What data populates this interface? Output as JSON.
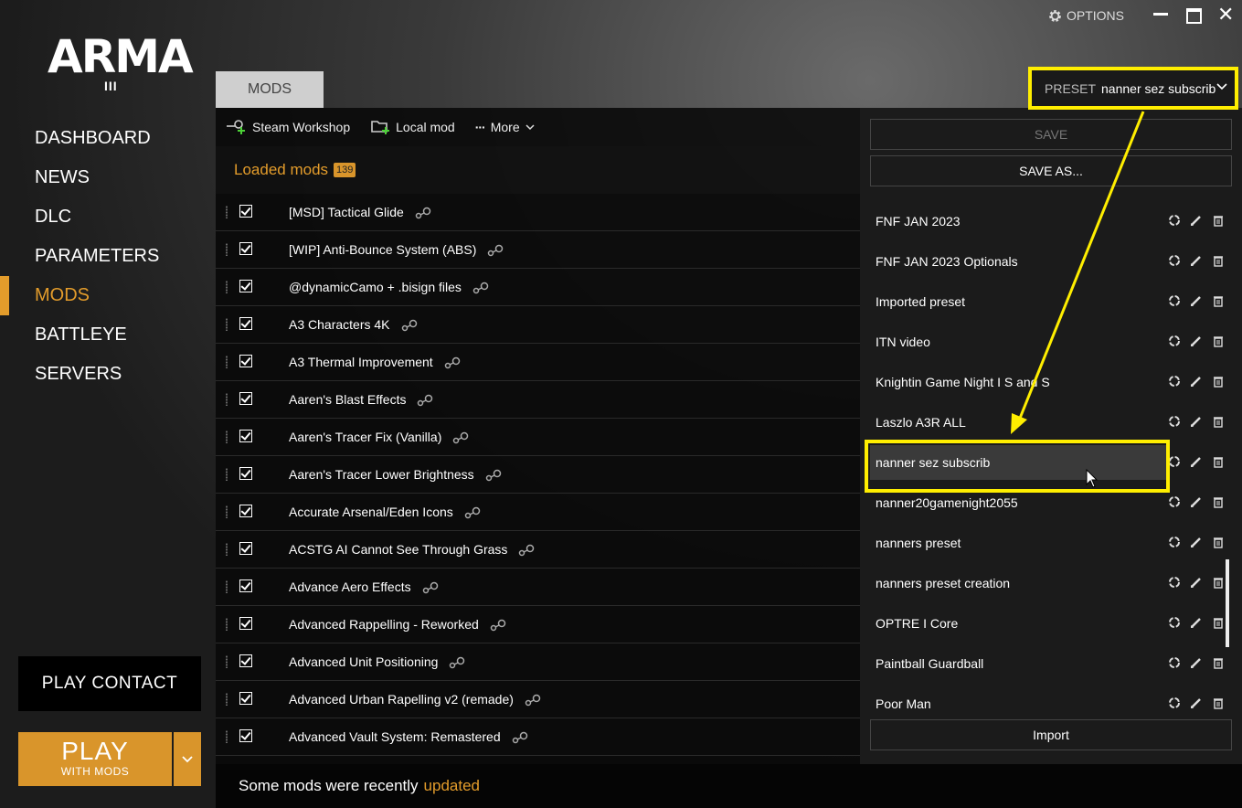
{
  "header": {
    "logo_text": "ARMA",
    "logo_numeral": "III",
    "options_label": "OPTIONS"
  },
  "sidebar": {
    "items": [
      {
        "label": "DASHBOARD"
      },
      {
        "label": "NEWS"
      },
      {
        "label": "DLC"
      },
      {
        "label": "PARAMETERS"
      },
      {
        "label": "MODS",
        "active": true
      },
      {
        "label": "BATTLEYE"
      },
      {
        "label": "SERVERS"
      }
    ],
    "play_contact_label": "PLAY CONTACT",
    "play_label": "PLAY",
    "play_sub_label": "WITH MODS"
  },
  "tabs": [
    {
      "label": "MODS"
    }
  ],
  "toolbar": {
    "steam_workshop_label": "Steam Workshop",
    "local_mod_label": "Local mod",
    "more_label": "More"
  },
  "loaded": {
    "label": "Loaded mods",
    "count": "139"
  },
  "mods": [
    {
      "name": "[MSD] Tactical Glide",
      "checked": true
    },
    {
      "name": "[WIP] Anti-Bounce System (ABS)",
      "checked": true
    },
    {
      "name": "@dynamicCamo + .bisign files",
      "checked": true
    },
    {
      "name": "A3 Characters 4K",
      "checked": true
    },
    {
      "name": "A3 Thermal Improvement",
      "checked": true
    },
    {
      "name": "Aaren's Blast Effects",
      "checked": true
    },
    {
      "name": "Aaren's Tracer Fix (Vanilla)",
      "checked": true
    },
    {
      "name": "Aaren's Tracer Lower Brightness",
      "checked": true
    },
    {
      "name": "Accurate Arsenal/Eden Icons",
      "checked": true
    },
    {
      "name": "ACSTG AI Cannot See Through Grass",
      "checked": true
    },
    {
      "name": "Advance Aero Effects",
      "checked": true
    },
    {
      "name": "Advanced Rappelling - Reworked",
      "checked": true
    },
    {
      "name": "Advanced Unit Positioning",
      "checked": true
    },
    {
      "name": "Advanced Urban Rapelling v2 (remade)",
      "checked": true
    },
    {
      "name": "Advanced Vault System: Remastered",
      "checked": true
    }
  ],
  "preset": {
    "label": "PRESET",
    "value": "nanner sez subscrib",
    "save_label": "SAVE",
    "save_as_label": "SAVE AS...",
    "import_label": "Import",
    "items": [
      {
        "name": "FNF JAN 2023"
      },
      {
        "name": "FNF JAN 2023 Optionals"
      },
      {
        "name": "Imported preset"
      },
      {
        "name": "ITN video"
      },
      {
        "name": "Knightin Game Night I S and S"
      },
      {
        "name": "Laszlo A3R ALL"
      },
      {
        "name": "nanner sez subscrib",
        "hovered": true
      },
      {
        "name": "nanner20gamenight2055"
      },
      {
        "name": "nanners preset"
      },
      {
        "name": "nanners preset creation"
      },
      {
        "name": "OPTRE I Core"
      },
      {
        "name": "Paintball Guardball"
      },
      {
        "name": "Poor Man"
      }
    ]
  },
  "footer": {
    "message": "Some mods were recently",
    "link": "updated"
  },
  "colors": {
    "accent": "#e39c2b",
    "annotation": "#ffee00"
  }
}
